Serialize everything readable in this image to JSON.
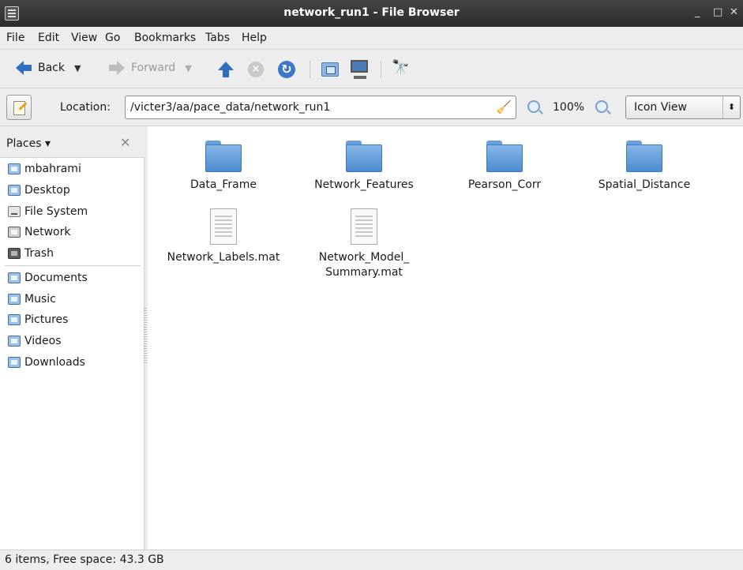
{
  "window": {
    "title": "network_run1 - File Browser",
    "min": "_",
    "max": "□",
    "close": "✕"
  },
  "menu": [
    "File",
    "Edit",
    "View",
    "Go",
    "Bookmarks",
    "Tabs",
    "Help"
  ],
  "toolbar": {
    "back": "Back",
    "forward": "Forward"
  },
  "location": {
    "label": "Location:",
    "path": "/victer3/aa/pace_data/network_run1",
    "zoom": "100%",
    "view": "Icon View"
  },
  "sidebar": {
    "header": "Places",
    "items": [
      "mbahrami",
      "Desktop",
      "File System",
      "Network",
      "Trash"
    ],
    "bookmarks": [
      "Documents",
      "Music",
      "Pictures",
      "Videos",
      "Downloads"
    ]
  },
  "files": {
    "folders": [
      "Data_Frame",
      "Network_Features",
      "Pearson_Corr",
      "Spatial_Distance"
    ],
    "documents": [
      "Network_Labels.mat",
      "Network_Model_\nSummary.mat"
    ]
  },
  "status": "6 items, Free space: 43.3 GB"
}
